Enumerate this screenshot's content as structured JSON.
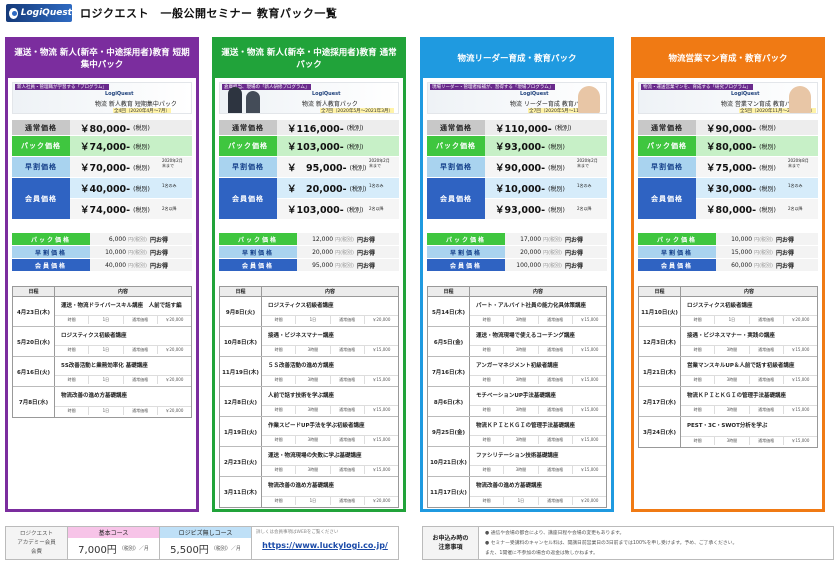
{
  "header": {
    "logo": "LogiQuest",
    "title": "ロジクエスト　一般公開セミナー 教育パック一覧"
  },
  "colors": {
    "purple": "#7b2d9e",
    "green": "#21a33a",
    "blue": "#1f9ae0",
    "orange": "#f07a14"
  },
  "price_labels": {
    "standard": "通常価格",
    "pack": "パック価格",
    "early": "早割価格",
    "member": "会員価格"
  },
  "saving_labels": {
    "pack": "パック価格",
    "early": "早割価格",
    "member": "会員価格"
  },
  "saving_suffix": "円お得",
  "saving_unit": "円(税別)",
  "sched_headers": {
    "date": "日程",
    "content": "内容"
  },
  "meta_labels": {
    "days": "時間",
    "std": "通常価格"
  },
  "columns": [
    {
      "title": "運送・物流 新人(新卒・中途採用者)教育 短期集中パック",
      "banner": {
        "tag": "新人社員・管理職が学習する「プログラム」",
        "brand": "LogiQuest",
        "name": "物流 新人教育 短期集中パック",
        "sub": "全4回（2020年4月〜7月）"
      },
      "standard": "￥80,000-",
      "standard_tax": "(税別)",
      "pack": "￥74,000-",
      "pack_tax": "(税別)",
      "early": "￥70,000-",
      "early_tax": "(税別)",
      "early_note": "2020年2月末まで",
      "member1": "￥40,000-",
      "member1_tax": "(税別)",
      "member1_note": "1名のみ",
      "member2": "￥74,000-",
      "member2_tax": "(税別)",
      "member2_note": "2名以降",
      "savings": [
        "6,000",
        "10,000",
        "40,000"
      ],
      "sessions": [
        {
          "date": "4月23日(木)",
          "title": "運送・物流ドライバースキル講座　人前で話す編",
          "days": "1日",
          "price": "￥20,000"
        },
        {
          "date": "5月20日(水)",
          "title": "ロジスティクス初級者講座",
          "days": "1日",
          "price": "￥20,000"
        },
        {
          "date": "6月16日(火)",
          "title": "5S改善活動と業務効率化 基礎講座",
          "days": "1日",
          "price": "￥20,000"
        },
        {
          "date": "7月8日(水)",
          "title": "物流改善の進め方基礎講座",
          "days": "1日",
          "price": "￥20,000"
        }
      ]
    },
    {
      "title": "運送・物流 新人(新卒・中途採用者)教育 通常パック",
      "banner": {
        "tag": "倉庫担当、現場の「新人研修プログラム」",
        "brand": "LogiQuest",
        "name": "物流 新人教育パック",
        "sub": "全7回（2020年5月〜2021年3月）"
      },
      "standard": "￥116,000-",
      "standard_tax": "(税別)",
      "pack": "￥103,000-",
      "pack_tax": "(税別)",
      "early": "￥　95,000-",
      "early_tax": "(税別)",
      "early_note": "2020年2月末まで",
      "member1": "￥　20,000-",
      "member1_tax": "(税別)",
      "member1_note": "1名のみ",
      "member2": "￥103,000-",
      "member2_tax": "(税別)",
      "member2_note": "2名以降",
      "savings": [
        "12,000",
        "20,000",
        "95,000"
      ],
      "sessions": [
        {
          "date": "9月8日(火)",
          "title": "ロジスティクス初級者講座",
          "days": "1日",
          "price": "￥20,000"
        },
        {
          "date": "10月8日(木)",
          "title": "接遇・ビジネスマナー講座",
          "days": "3時間",
          "price": "￥15,000"
        },
        {
          "date": "11月19日(木)",
          "title": "５Ｓ改善活動の進め方講座",
          "days": "3時間",
          "price": "￥15,000"
        },
        {
          "date": "12月8日(火)",
          "title": "人前で話す技術を学ぶ講座",
          "days": "3時間",
          "price": "￥15,000"
        },
        {
          "date": "1月19日(火)",
          "title": "作業スピードUP手法を学ぶ初級者講座",
          "days": "3時間",
          "price": "￥15,000"
        },
        {
          "date": "2月23日(火)",
          "title": "運送・物流現場の失敗に学ぶ基礎講座",
          "days": "3時間",
          "price": "￥15,000"
        },
        {
          "date": "3月11日(木)",
          "title": "物流改善の進め方基礎講座",
          "days": "1日",
          "price": "￥20,000"
        }
      ]
    },
    {
      "title": "物流リーダー育成・教育パック",
      "banner": {
        "tag": "現場リーダー・管理者候補が、習得する「現場プログラム」",
        "brand": "LogiQuest",
        "name": "物流 リーダー育成 教育パック",
        "sub": "全7回（2020年5月〜11月）"
      },
      "standard": "￥110,000-",
      "standard_tax": "(税別)",
      "pack": "￥93,000-",
      "pack_tax": "(税別)",
      "early": "￥90,000-",
      "early_tax": "(税別)",
      "early_note": "2020年2月末まで",
      "member1": "￥10,000-",
      "member1_tax": "(税別)",
      "member1_note": "1名のみ",
      "member2": "￥93,000-",
      "member2_tax": "(税別)",
      "member2_note": "2名以降",
      "savings": [
        "17,000",
        "20,000",
        "100,000"
      ],
      "sessions": [
        {
          "date": "5月14日(木)",
          "title": "パート・アルバイト社員の能力化具体策講座",
          "days": "3時間",
          "price": "￥15,000"
        },
        {
          "date": "6月5日(金)",
          "title": "運送・物流現場で使えるコーチング講座",
          "days": "3時間",
          "price": "￥15,000"
        },
        {
          "date": "7月16日(木)",
          "title": "アンガーマネジメント初級者講座",
          "days": "3時間",
          "price": "￥15,000"
        },
        {
          "date": "8月6日(木)",
          "title": "モチベーションUP手法基礎講座",
          "days": "3時間",
          "price": "￥15,000"
        },
        {
          "date": "9月25日(金)",
          "title": "物流ＫＰＩとＫＧＩの管理手法基礎講座",
          "days": "3時間",
          "price": "￥15,000"
        },
        {
          "date": "10月21日(水)",
          "title": "ファシリテーション技術基礎講座",
          "days": "3時間",
          "price": "￥15,000"
        },
        {
          "date": "11月17日(火)",
          "title": "物流改善の進め方基礎講座",
          "days": "1日",
          "price": "￥20,000"
        }
      ]
    },
    {
      "title": "物流営業マン育成・教育パック",
      "banner": {
        "tag": "物流・運送営業マンを、育成する「研究プログラム」",
        "brand": "LogiQuest",
        "name": "物流 営業マン育成 教育パック",
        "sub": "全5回（2020年11月〜2021年3月）"
      },
      "standard": "￥90,000-",
      "standard_tax": "(税別)",
      "pack": "￥80,000-",
      "pack_tax": "(税別)",
      "early": "￥75,000-",
      "early_tax": "(税別)",
      "early_note": "2020年8月末まで",
      "member1": "￥30,000-",
      "member1_tax": "(税別)",
      "member1_note": "1名のみ",
      "member2": "￥80,000-",
      "member2_tax": "(税別)",
      "member2_note": "2名以降",
      "savings": [
        "10,000",
        "15,000",
        "60,000"
      ],
      "sessions": [
        {
          "date": "11月10日(火)",
          "title": "ロジスティクス初級者講座",
          "days": "1日",
          "price": "￥20,000"
        },
        {
          "date": "12月3日(木)",
          "title": "接遇・ビジネスマナー・実践の講座",
          "days": "3時間",
          "price": "￥15,000"
        },
        {
          "date": "1月21日(木)",
          "title": "営業マンスキルUP＆人前で話す初級者講座",
          "days": "3時間",
          "price": "￥15,000"
        },
        {
          "date": "2月17日(水)",
          "title": "物流ＫＰＩとＫＧＩの管理手法基礎講座",
          "days": "3時間",
          "price": "￥15,000"
        },
        {
          "date": "3月24日(水)",
          "title": "PEST・3C・SWOT分析を学ぶ",
          "days": "3時間",
          "price": "￥15,000"
        }
      ]
    }
  ],
  "footer_left": {
    "label1": "ロジクエスト",
    "label2": "アカデミー会員",
    "label3": "会費",
    "basic_title": "基本コース",
    "basic_value": "7,000円",
    "basic_unit": "（税別）／月",
    "unlimited_title": "ロジビズ無しコース",
    "unlimited_value": "5,500円",
    "unlimited_unit": "（税別）／月",
    "note": "詳しくは会員事項はWEBをご覧ください",
    "url": "https://www.luckylogi.co.jp/"
  },
  "footer_right": {
    "label1": "お申込み時の",
    "label2": "注意事項",
    "note1": "● 通信や会場の都合により、講座日程や会場の変更もあります。",
    "note2": "● セミナー受講料のキャンセル料は、開講日前営業日の3日前までは100%を申し受けます。予め、ご了承ください。",
    "note3": "また、1開催に不参加の場合の返金は致しかねます。"
  }
}
